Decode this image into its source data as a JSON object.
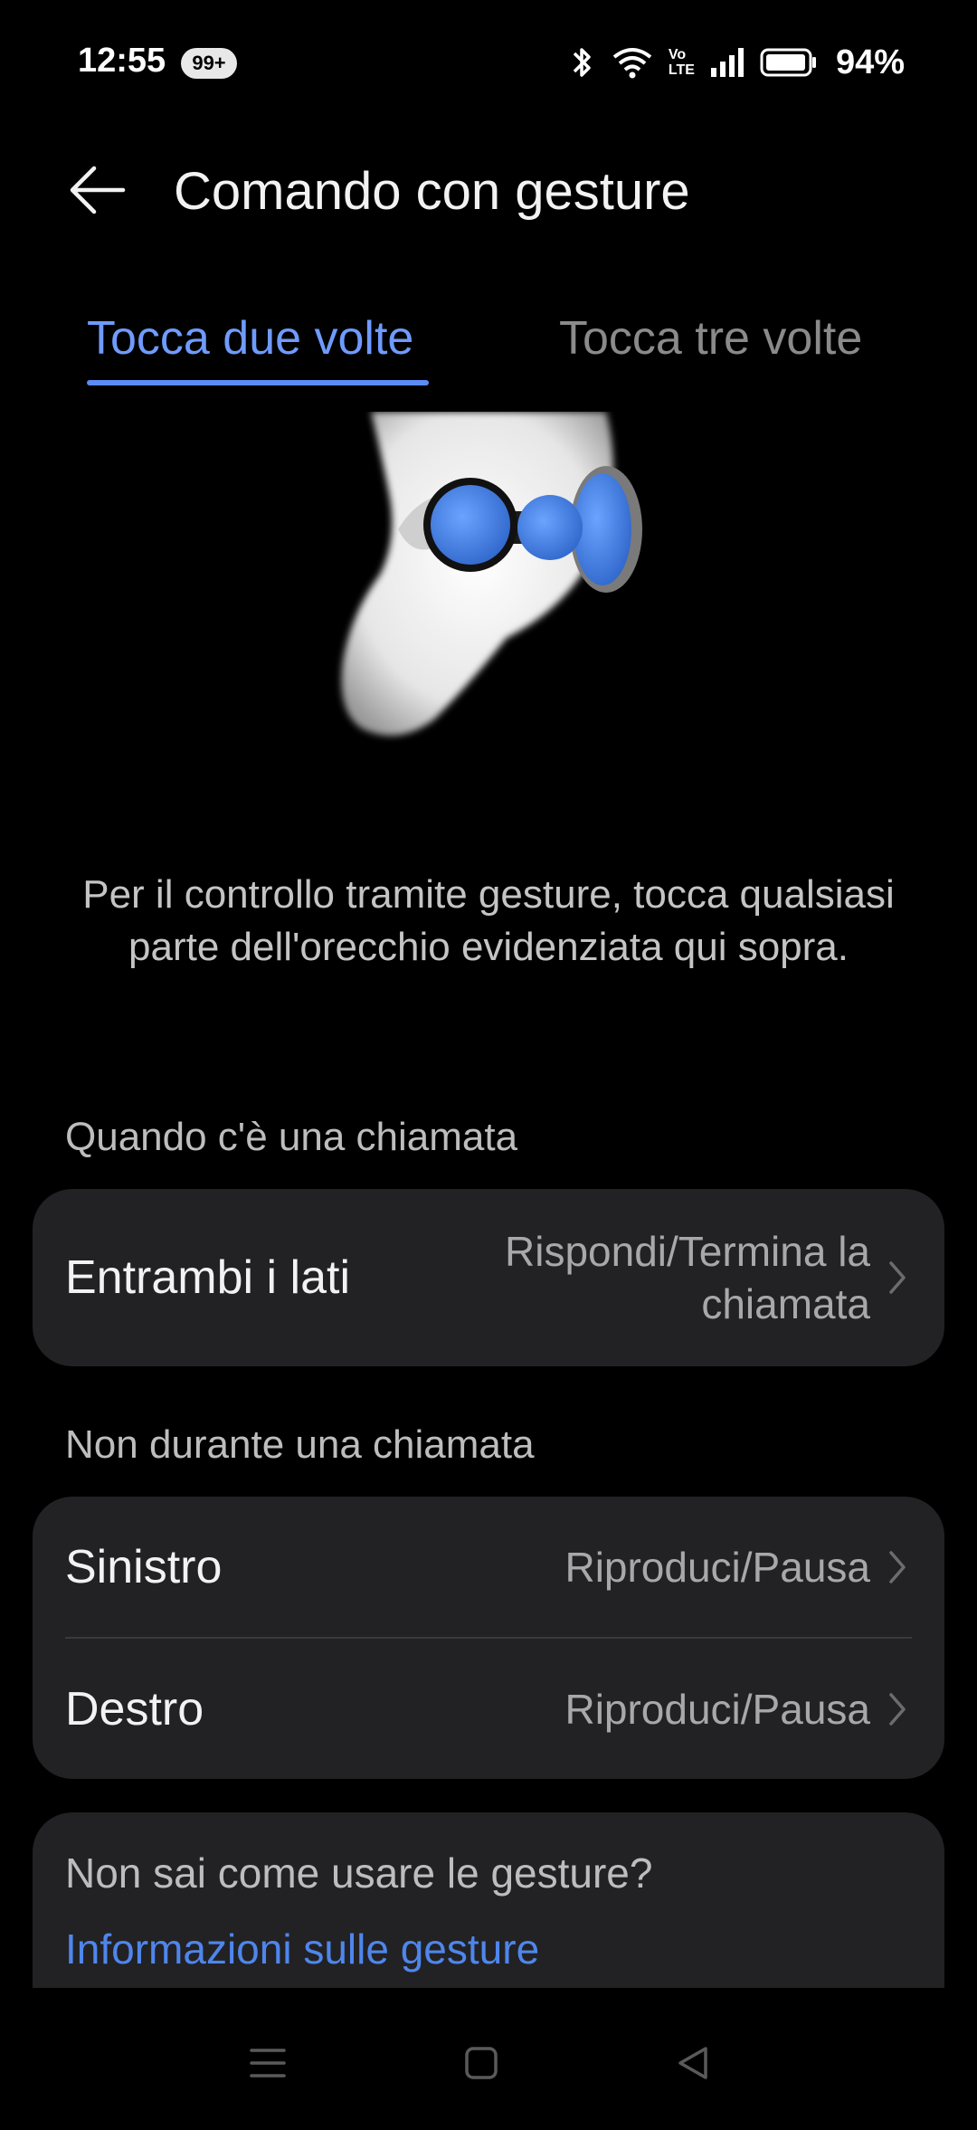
{
  "status_bar": {
    "time": "12:55",
    "notification_badge": "99+",
    "battery_percent": "94%",
    "icons": [
      "bluetooth-icon",
      "wifi-icon",
      "volte-icon",
      "signal-icon",
      "battery-icon"
    ],
    "volte_top": "Vo",
    "volte_bottom": "LTE"
  },
  "header": {
    "title": "Comando con gesture",
    "back_icon": "arrow-left-icon"
  },
  "tabs": [
    {
      "label": "Tocca due volte",
      "active": true
    },
    {
      "label": "Tocca tre volte",
      "active": false
    }
  ],
  "description": "Per il controllo tramite gesture, tocca qualsiasi parte dell'orecchio evidenziata qui sopra.",
  "call_section": {
    "label": "Quando c'è una chiamata",
    "rows": [
      {
        "label": "Entrambi i lati",
        "value_line1": "Rispondi/Termina la",
        "value_line2": "chiamata"
      }
    ]
  },
  "no_call_section": {
    "label": "Non durante una chiamata",
    "rows": [
      {
        "label": "Sinistro",
        "value": "Riproduci/Pausa"
      },
      {
        "label": "Destro",
        "value": "Riproduci/Pausa"
      }
    ]
  },
  "help": {
    "question": "Non sai come usare le gesture?",
    "link": "Informazioni sulle gesture"
  },
  "colors": {
    "accent": "#6f9bff",
    "link": "#4f86ec",
    "card_bg": "#222224",
    "highlight_blue": "#3f7fe0"
  },
  "nav_bar": {
    "icons": [
      "menu-icon",
      "home-icon",
      "back-icon"
    ]
  }
}
